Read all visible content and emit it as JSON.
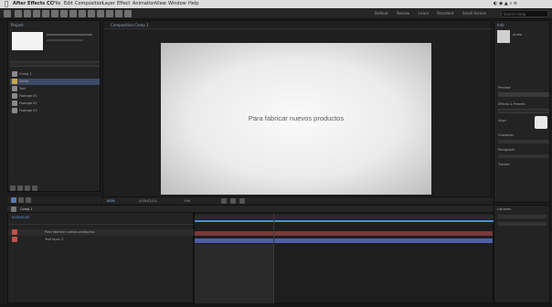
{
  "menubar": {
    "app": "After Effects CC",
    "items": [
      "File",
      "Edit",
      "Composition",
      "Layer",
      "Effect",
      "Animation",
      "View",
      "Window",
      "Help"
    ]
  },
  "toolbar": {
    "workspaces": [
      "Default",
      "Review",
      "Learn",
      "Standard",
      "Small Screen",
      "Libraries"
    ],
    "search_placeholder": "Search Help"
  },
  "project_panel": {
    "title": "Project",
    "items": [
      "Comp 1",
      "Solids",
      "Text",
      "Footage 01",
      "Footage 02",
      "Footage 03"
    ]
  },
  "composition": {
    "tab": "Composition Comp 1",
    "caption": "Para fabricar nuevos productos",
    "zoom": "100%",
    "timecode": "0;00;03;14",
    "resolution": "Full"
  },
  "timeline": {
    "tab": "Comp 1",
    "timecode": "0;00;00;00",
    "layers": [
      "Para fabricar nuevos productos",
      "Text layer 2"
    ],
    "colors": {
      "track1": "#7a3a3a",
      "track2": "#4c5fa8",
      "playhead": "#4a8fd8"
    }
  },
  "right_panel": {
    "title": "Info",
    "sections": [
      "Audio",
      "Preview",
      "Effects & Presets",
      "Align",
      "Libraries",
      "Character",
      "Paragraph",
      "Tracker"
    ]
  },
  "colors": {
    "accent": "#2d6cdf",
    "viewer": "#f2f2f2"
  }
}
